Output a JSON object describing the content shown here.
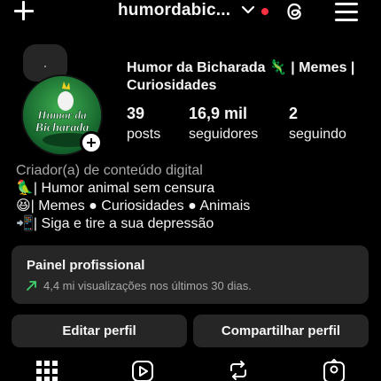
{
  "header": {
    "username": "humordabic...",
    "colors": {
      "notification_dot": "#ff3040"
    }
  },
  "profile": {
    "display_name": "Humor da Bicharada 🦎 | Memes | Curiosidades",
    "avatar_text": "Humor da Bicharada",
    "stats": [
      {
        "value": "39",
        "label": "posts"
      },
      {
        "value": "16,9 mil",
        "label": "seguidores"
      },
      {
        "value": "2",
        "label": "seguindo"
      }
    ],
    "bio": {
      "category": "Criador(a) de conteúdo digital",
      "lines": [
        "🦜| Humor animal sem censura",
        "😆| Memes ● Curiosidades ● Animais",
        "📲| Siga e tire a sua depressão"
      ]
    }
  },
  "professional_panel": {
    "title": "Painel profissional",
    "subtitle": "4,4 mi visualizações nos últimos 30 dias.",
    "trend_color": "#3fd06a"
  },
  "actions": {
    "edit": "Editar perfil",
    "share": "Compartilhar perfil"
  },
  "tabs": [
    "grid-icon",
    "reels-icon",
    "reposts-icon",
    "tagged-icon"
  ]
}
